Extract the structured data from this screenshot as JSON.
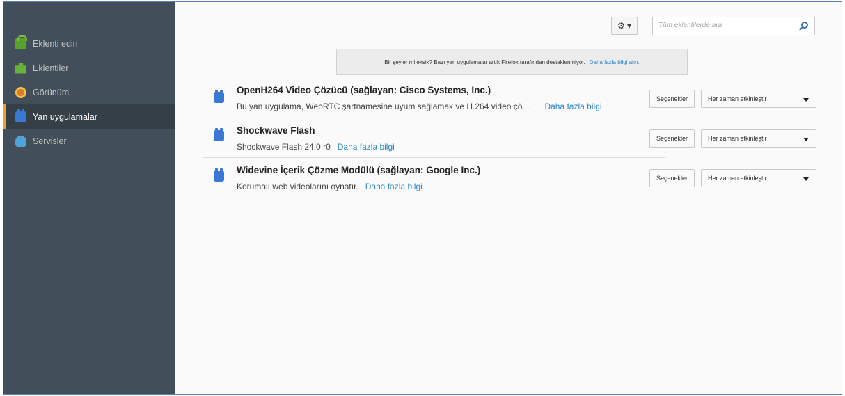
{
  "sidebar": {
    "items": [
      {
        "label": "Eklenti edin",
        "icon": "get-addons-icon"
      },
      {
        "label": "Eklentiler",
        "icon": "extensions-icon"
      },
      {
        "label": "Görünüm",
        "icon": "appearance-icon"
      },
      {
        "label": "Yan uygulamalar",
        "icon": "plugins-icon",
        "selected": true
      },
      {
        "label": "Servisler",
        "icon": "services-icon"
      }
    ]
  },
  "toolbar": {
    "gear_label": "⚙ ▾",
    "search_placeholder": "Tüm eklentilerde ara"
  },
  "notice": {
    "text": "Bir şeyler mi eksik? Bazı yan uygulamalar artık Firefox tarafından desteklenmiyor.",
    "link": "Daha fazla bilgi alın."
  },
  "plugins": [
    {
      "name": "OpenH264 Video Çözücü (sağlayan: Cisco Systems, Inc.)",
      "description": "Bu yan uygulama, WebRTC şartnamesine uyum sağlamak ve H.264 video çö...",
      "more": "Daha fazla bilgi",
      "options": "Seçenekler",
      "state": "Her zaman etkinleştir"
    },
    {
      "name": "Shockwave Flash",
      "description": "Shockwave Flash 24.0 r0",
      "more": "Daha fazla bilgi",
      "options": "Seçenekler",
      "state": "Her zaman etkinleştir"
    },
    {
      "name": "Widevine İçerik Çözme Modülü (sağlayan: Google Inc.)",
      "description": "Korumalı web videolarını oynatır.",
      "more": "Daha fazla bilgi",
      "options": "Seçenekler",
      "state": "Her zaman etkinleştir"
    }
  ],
  "colors": {
    "sidebar_bg": "#424f5a",
    "sidebar_selected_bg": "#343f48",
    "selected_accent": "#f0a030",
    "link": "#2d87c9"
  }
}
